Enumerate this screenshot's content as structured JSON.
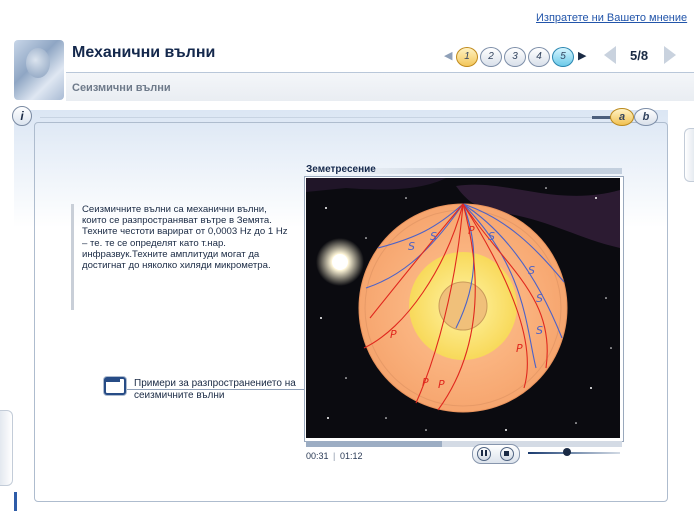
{
  "feedback": {
    "label": "Изпратете ни Вашето мнение"
  },
  "header": {
    "title": "Механични вълни",
    "subtitle": "Сеизмични вълни",
    "sections": [
      "1",
      "2",
      "3",
      "4",
      "5"
    ],
    "current_section": "5",
    "page_counter": "5/8"
  },
  "panel": {
    "info_label": "i",
    "tabs": [
      "a",
      "b"
    ],
    "active_tab": "a"
  },
  "description": {
    "text": "Сеизмичните вълни са механични вълни, които се разпространяват вътре в Земята. Техните честоти варират от 0,0003 Hz до 1 Hz – те. те се определят като т.нар. инфразвук.Техните амплитуди могат да достигнат до няколко хиляди микрометра."
  },
  "examples_link": {
    "label": "Примери за разпространението на сеизмичните вълни"
  },
  "video": {
    "title": "Земетресение",
    "wave_labels": {
      "s": "S",
      "p": "P"
    },
    "elapsed": "00:31",
    "separator": "|",
    "total": "01:12",
    "progress": 0.43,
    "volume": 0.42
  },
  "colors": {
    "accent": "#14284c",
    "s_wave": "#4b62c9",
    "p_wave": "#e0281e",
    "earth_outer": "#f6ac76",
    "earth_core": "#fbe46e"
  }
}
